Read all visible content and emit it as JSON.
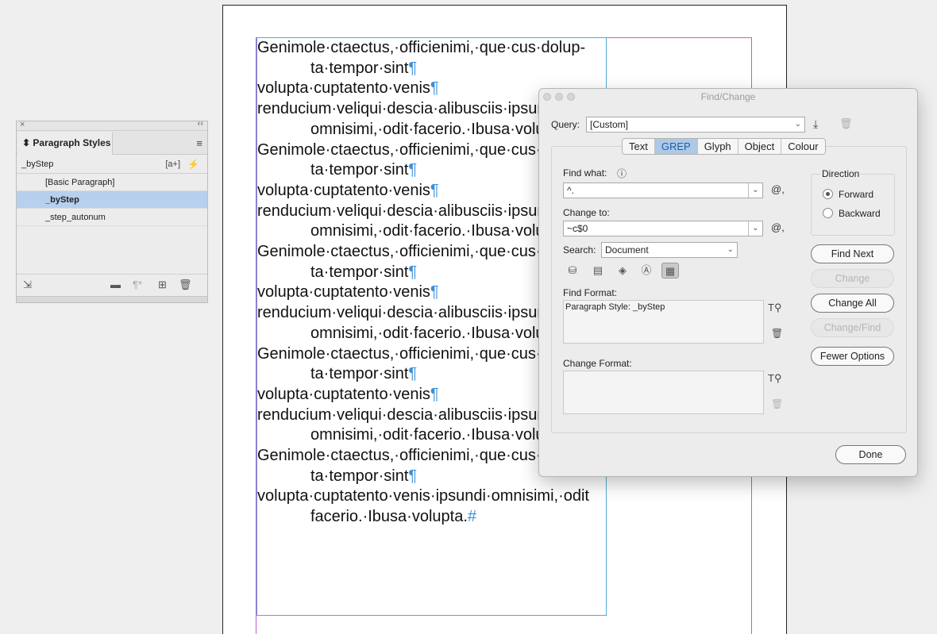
{
  "document": {
    "paragraphs": [
      {
        "first": "Genimole·ctaectus,·officienimi,·que·cus·dolup-",
        "cont": "ta·tempor·sint",
        "end": "¶"
      },
      {
        "first": "volupta·cuptatento·venis",
        "cont": "",
        "end": "¶"
      },
      {
        "first": "renducium·veliqui·descia·alibusciis·ipsundi·",
        "cont": "omnisimi,·odit·facerio.·Ibusa·volupta.",
        "end": "¶"
      },
      {
        "first": "Genimole·ctaectus,·officienimi,·que·cus·dolup-",
        "cont": "ta·tempor·sint",
        "end": "¶"
      },
      {
        "first": "volupta·cuptatento·venis",
        "cont": "",
        "end": "¶"
      },
      {
        "first": "renducium·veliqui·descia·alibusciis·ipsundi·",
        "cont": "omnisimi,·odit·facerio.·Ibusa·volupta.",
        "end": "¶"
      },
      {
        "first": "Genimole·ctaectus,·officienimi,·que·cus·dolup-",
        "cont": "ta·tempor·sint",
        "end": "¶"
      },
      {
        "first": "volupta·cuptatento·venis",
        "cont": "",
        "end": "¶"
      },
      {
        "first": "renducium·veliqui·descia·alibusciis·ipsundi·",
        "cont": "omnisimi,·odit·facerio.·Ibusa·volupta.",
        "end": "¶"
      },
      {
        "first": "Genimole·ctaectus,·officienimi,·que·cus·dolup-",
        "cont": "ta·tempor·sint",
        "end": "¶"
      },
      {
        "first": "volupta·cuptatento·venis",
        "cont": "",
        "end": "¶"
      },
      {
        "first": "renducium·veliqui·descia·alibusciis·ipsundi·",
        "cont": "omnisimi,·odit·facerio.·Ibusa·volupta.",
        "end": "¶"
      },
      {
        "first": "Genimole·ctaectus,·officienimi,·que·cus·dolup-",
        "cont": "ta·tempor·sint",
        "end": "¶"
      },
      {
        "first": "volupta·cuptatento·venis·ipsundi·omnisimi,·odit",
        "cont": "facerio.·Ibusa·volupta.",
        "end": "#"
      }
    ]
  },
  "paragraph_styles": {
    "title": "Paragraph Styles",
    "current": "_byStep",
    "new_style_from_selection": "[a+]",
    "items": [
      "[Basic Paragraph]",
      "_byStep",
      "_step_autonum"
    ],
    "selected_index": 1
  },
  "find_change": {
    "title": "Find/Change",
    "query_label": "Query:",
    "query_value": "[Custom]",
    "tabs": [
      "Text",
      "GREP",
      "Glyph",
      "Object",
      "Colour"
    ],
    "active_tab": "GREP",
    "find_what_label": "Find what:",
    "find_what_value": "^.",
    "change_to_label": "Change to:",
    "change_to_value": "~c$0",
    "search_label": "Search:",
    "search_value": "Document",
    "find_format_label": "Find Format:",
    "find_format_value": "Paragraph Style: _byStep",
    "change_format_label": "Change Format:",
    "change_format_value": "",
    "direction_label": "Direction",
    "direction_options": [
      "Forward",
      "Backward"
    ],
    "direction_selected": "Forward",
    "buttons": {
      "find_next": "Find Next",
      "change": "Change",
      "change_all": "Change All",
      "change_find": "Change/Find",
      "fewer_options": "Fewer Options",
      "done": "Done"
    }
  }
}
